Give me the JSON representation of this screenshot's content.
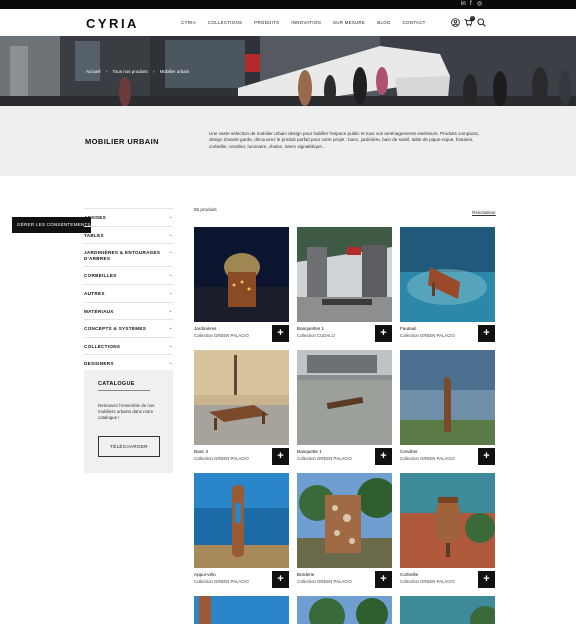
{
  "topbar": {
    "social_icons": [
      "linkedin-icon",
      "facebook-icon",
      "instagram-icon"
    ],
    "social_glyphs": [
      "in",
      "f",
      "◎"
    ]
  },
  "header": {
    "logo": "CYRIA",
    "nav": [
      "CYRIA",
      "COLLECTIONS",
      "PRODUITS",
      "INNOVATION",
      "SUR MESURE",
      "BLOG",
      "CONTACT"
    ],
    "icons": [
      "user-icon",
      "cart-icon",
      "search-icon"
    ],
    "cart_count": "0"
  },
  "breadcrumb": [
    "Accueil",
    "Tous nos produits",
    "Mobilier urbain"
  ],
  "intro": {
    "title": "MOBILIER URBAIN",
    "text": "Une vaste sélection de mobilier urbain design pour habiller l'espace public et tous vos aménagements extérieurs. Produits compacts, design d'avant-garde, découvrez le produit parfait pour votre projet : banc, jardinière, bain de soleil, table de pique-nique, fontaine, corbeille, cendrier, luminaire, chaise, totem signalétique..."
  },
  "consent_label": "GÉRER LES CONSENTEMENTS",
  "sidebar": [
    {
      "label": "ASSISES",
      "chev": "⌄"
    },
    {
      "label": "TABLES",
      "chev": "⌄"
    },
    {
      "label": "JARDINIÈRES & ENTOURAGES D'ARBRES",
      "chev": "⌄"
    },
    {
      "label": "CORBEILLES",
      "chev": "⌄"
    },
    {
      "label": "AUTRES",
      "chev": "⌄"
    },
    {
      "label": "MATÉRIAUX",
      "chev": "⌄"
    },
    {
      "label": "CONCEPTS & SYSTÈMES",
      "chev": "⌄"
    },
    {
      "label": "COLLECTIONS",
      "chev": "⌄"
    },
    {
      "label": "DESIGNERS",
      "chev": "⌄"
    }
  ],
  "catalog": {
    "title": "CATALOGUE",
    "text": "Retrouvez l'ensemble de nos mobiliers urbains dans notre catalogue !",
    "button": "TÉLÉCHARGER"
  },
  "products_count": "85 produits",
  "reset_label": "Réinitialiser",
  "plus_label": "+",
  "products": [
    {
      "name": "Jardinières",
      "collection": "Collection GREEN PALACIO",
      "theme": "night"
    },
    {
      "name": "Banquettes 1",
      "collection": "Collection CUDALO",
      "theme": "street"
    },
    {
      "name": "Fauteuil",
      "collection": "Collection GREEN PALACIO",
      "theme": "water"
    },
    {
      "name": "Banc 2",
      "collection": "Collection GREEN PALACIO",
      "theme": "wall"
    },
    {
      "name": "Banquette 1",
      "collection": "Collection GREEN PALACIO",
      "theme": "ground"
    },
    {
      "name": "Cendrier",
      "collection": "Collection GREEN PALACIO",
      "theme": "lake"
    },
    {
      "name": "Appui-vélo",
      "collection": "Collection GREEN PALACIO",
      "theme": "sea"
    },
    {
      "name": "Borderie",
      "collection": "Collection GREEN PALACIO",
      "theme": "forest"
    },
    {
      "name": "Corbeille",
      "collection": "Collection GREEN PALACIO",
      "theme": "canyon"
    }
  ]
}
